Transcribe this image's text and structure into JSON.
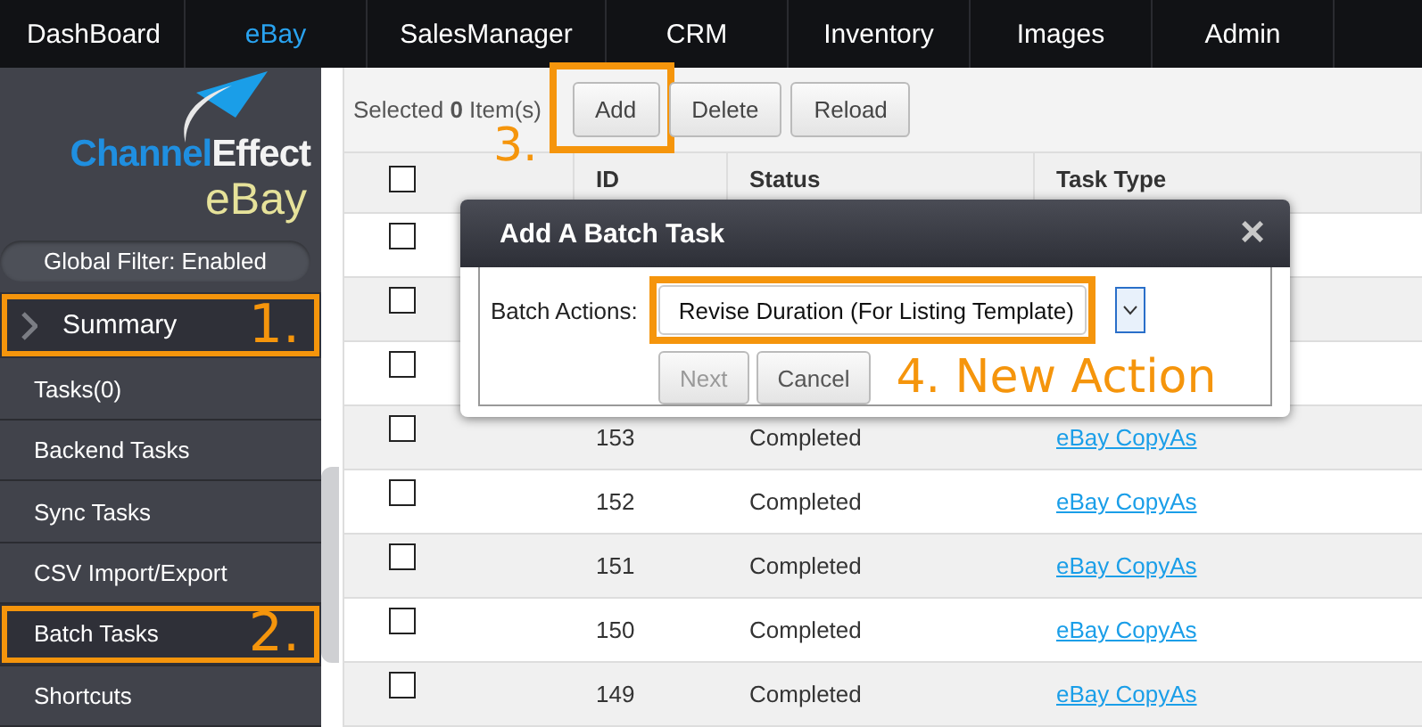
{
  "nav": {
    "tabs": [
      {
        "label": "DashBoard",
        "selected": false
      },
      {
        "label": "eBay",
        "selected": true
      },
      {
        "label": "SalesManager",
        "selected": false
      },
      {
        "label": "CRM",
        "selected": false
      },
      {
        "label": "Inventory",
        "selected": false
      },
      {
        "label": "Images",
        "selected": false
      },
      {
        "label": "Admin",
        "selected": false
      }
    ]
  },
  "sidebar": {
    "logo": {
      "primary": "Channel",
      "secondary": "Effect",
      "product": "eBay"
    },
    "global_filter": "Global Filter: Enabled",
    "summary": {
      "label": "Summary",
      "callout": "1."
    },
    "items": [
      {
        "label": "Tasks(0)",
        "selected": false
      },
      {
        "label": "Backend Tasks",
        "selected": false
      },
      {
        "label": "Sync Tasks",
        "selected": false
      },
      {
        "label": "CSV Import/Export",
        "selected": false
      },
      {
        "label": "Batch Tasks",
        "selected": true,
        "callout": "2."
      },
      {
        "label": "Shortcuts",
        "selected": false
      }
    ]
  },
  "toolbar": {
    "selected_prefix": "Selected ",
    "selected_count": "0",
    "selected_suffix": " Item(s)",
    "buttons": [
      {
        "label": "Add",
        "callout": "3."
      },
      {
        "label": "Delete"
      },
      {
        "label": "Reload"
      }
    ]
  },
  "table": {
    "header_checked": false,
    "columns": [
      "ID",
      "Status",
      "Task Type"
    ],
    "rows": [
      {
        "checked": false
      },
      {
        "checked": false
      },
      {
        "checked": false
      },
      {
        "checked": false,
        "id": "153",
        "status": "Completed",
        "task_type": "eBay CopyAs"
      },
      {
        "checked": false,
        "id": "152",
        "status": "Completed",
        "task_type": "eBay CopyAs"
      },
      {
        "checked": false,
        "id": "151",
        "status": "Completed",
        "task_type": "eBay CopyAs"
      },
      {
        "checked": false,
        "id": "150",
        "status": "Completed",
        "task_type": "eBay CopyAs"
      },
      {
        "checked": false,
        "id": "149",
        "status": "Completed",
        "task_type": "eBay CopyAs"
      }
    ]
  },
  "dialog": {
    "title": "Add A Batch Task",
    "close": "×",
    "field_label": "Batch Actions:",
    "value": "Revise Duration (For Listing Template)",
    "callout": "4. New Action",
    "buttons": [
      {
        "label": "Next",
        "disabled": true
      },
      {
        "label": "Cancel",
        "disabled": false
      }
    ]
  }
}
